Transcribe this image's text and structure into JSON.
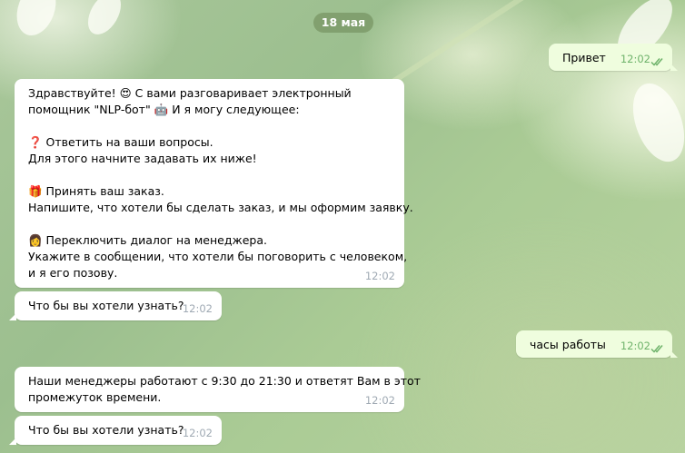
{
  "date_separator": "18 мая",
  "messages": {
    "m1": {
      "text": "Привет",
      "time": "12:02"
    },
    "m2": {
      "line1": "Здравствуйте! 😍 С вами разговаривает электронный",
      "line2": "помощник \"NLP-бот\" 🤖 И я могу следующее:",
      "line3": "❓ Ответить на ваши вопросы.",
      "line4": "Для этого начните задавать их ниже!",
      "line5": "🎁 Принять ваш заказ.",
      "line6": "Напишите, что хотели бы сделать заказ, и мы оформим заявку.",
      "line7": "👩 Переключить диалог на менеджера.",
      "line8": "Укажите в сообщении, что хотели бы поговорить с человеком,",
      "line9": "и я его позову.",
      "time": "12:02"
    },
    "m3": {
      "text": "Что бы вы хотели узнать?",
      "time": "12:02"
    },
    "m4": {
      "text": "часы работы",
      "time": "12:02"
    },
    "m5": {
      "line1": "Наши менеджеры работают с 9:30 до 21:30 и ответят Вам в этот",
      "line2": "промежуток времени.",
      "time": "12:02"
    },
    "m6": {
      "text": "Что бы вы хотели узнать?",
      "time": "12:02"
    }
  },
  "colors": {
    "incoming_bubble": "#ffffff",
    "outgoing_bubble": "#effdde",
    "read_checks": "#6fb36b",
    "date_pill": "#789664"
  },
  "icons": {
    "read_status": "double-check-icon"
  }
}
